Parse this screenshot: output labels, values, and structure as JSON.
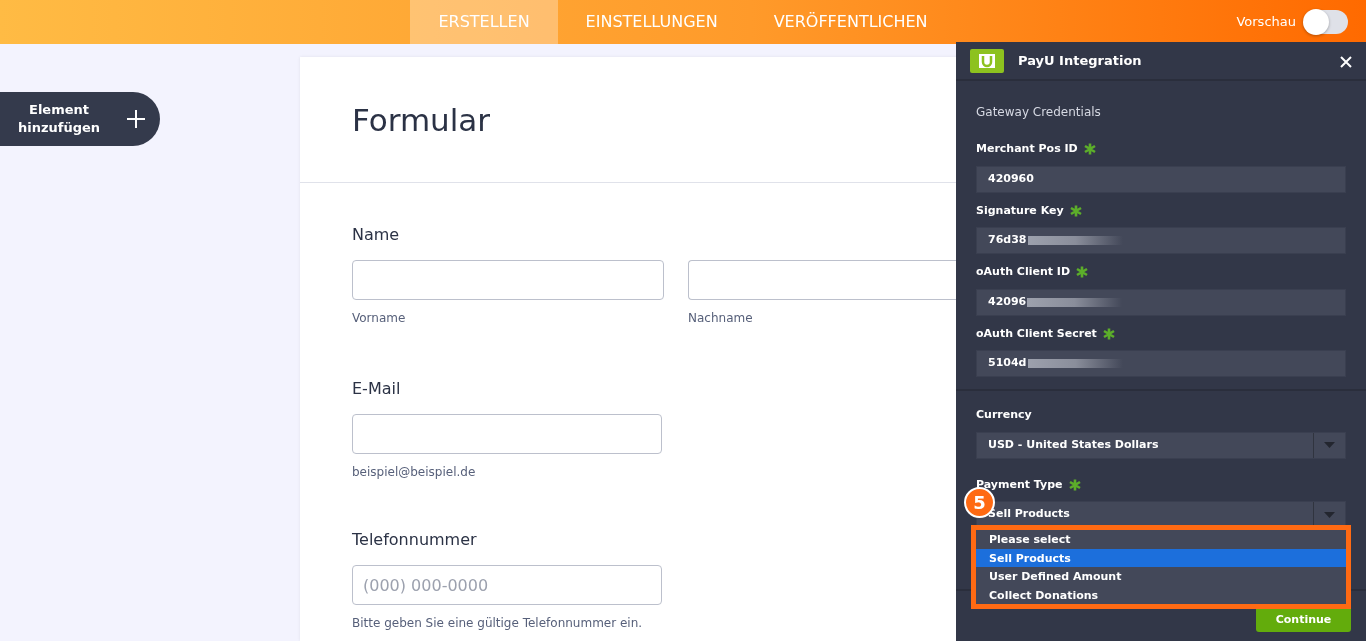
{
  "top_tabs": [
    {
      "label": "ERSTELLEN",
      "selected": true
    },
    {
      "label": "EINSTELLUNGEN",
      "selected": false
    },
    {
      "label": "VERÖFFENTLICHEN",
      "selected": false
    }
  ],
  "preview": {
    "label": "Vorschau",
    "on": false
  },
  "add_element": {
    "label": "Element hinzufügen"
  },
  "form": {
    "title": "Formular",
    "fields": [
      {
        "kind": "name",
        "label": "Name",
        "subs": [
          "Vorname",
          "Nachname"
        ]
      },
      {
        "kind": "single",
        "label": "E-Mail",
        "sub": "beispiel@beispiel.de"
      },
      {
        "kind": "single",
        "label": "Telefonnummer",
        "placeholder": "(000) 000-0000",
        "sub": "Bitte geben Sie eine gültige Telefonnummer ein."
      }
    ]
  },
  "panel": {
    "title": "PayU Integration",
    "section": "Gateway Credentials",
    "credentials": [
      {
        "label": "Merchant Pos ID",
        "required": true,
        "value": "420960",
        "blurred": false
      },
      {
        "label": "Signature Key",
        "required": true,
        "value": "76d38",
        "blurred": true
      },
      {
        "label": "oAuth Client ID",
        "required": true,
        "value": "42096",
        "blurred": true
      },
      {
        "label": "oAuth Client Secret",
        "required": true,
        "value": "5104d",
        "blurred": true
      }
    ],
    "selects": [
      {
        "label": "Currency",
        "required": false,
        "value": "USD - United States Dollars",
        "open": false
      },
      {
        "label": "Payment Type",
        "required": true,
        "value": "Sell Products",
        "open": true,
        "options": [
          {
            "label": "Please select",
            "selected": false
          },
          {
            "label": "Sell Products",
            "selected": true
          },
          {
            "label": "User Defined Amount",
            "selected": false
          },
          {
            "label": "Collect Donations",
            "selected": false
          }
        ]
      }
    ],
    "step_badge": "5",
    "continue": "Continue"
  }
}
